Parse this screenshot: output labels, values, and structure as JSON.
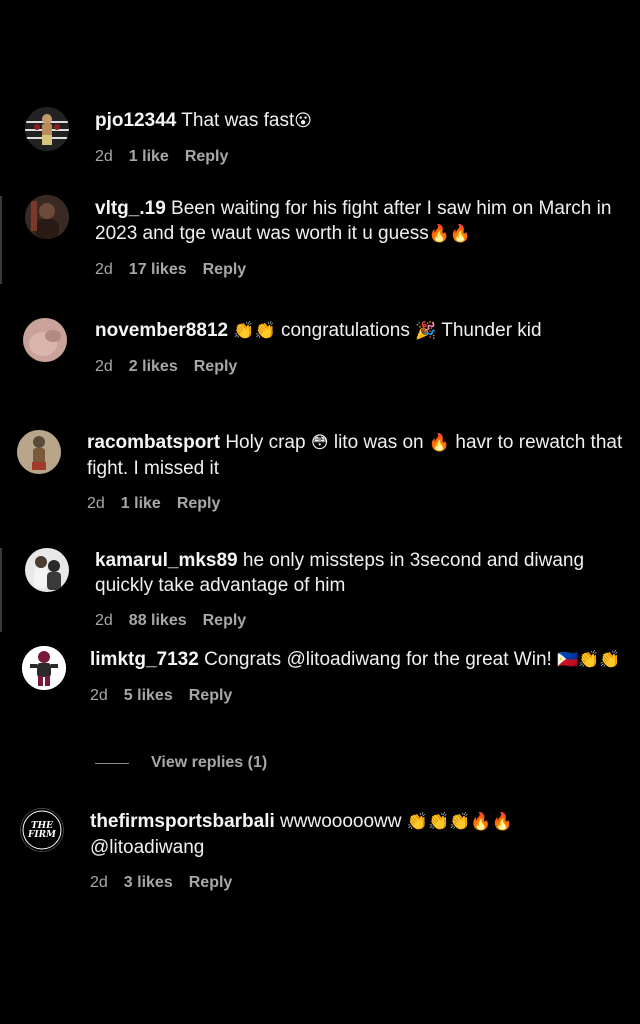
{
  "comments": [
    {
      "username": "pjo12344",
      "text": "That was fast",
      "emoji": "😮",
      "time": "2d",
      "likes": "1 like",
      "reply": "Reply"
    },
    {
      "username": "vltg_.19",
      "text": "Been waiting for his fight after I saw him on March in 2023 and tge waut was worth it u guess",
      "emoji": "🔥🔥",
      "time": "2d",
      "likes": "17 likes",
      "reply": "Reply"
    },
    {
      "username": "november8812",
      "emoji_pre": "👏👏",
      "text": "congratulations",
      "emoji_mid": "🎉",
      "text2": "Thunder kid",
      "time": "2d",
      "likes": "2 likes",
      "reply": "Reply"
    },
    {
      "username": "racombatsport",
      "text": "Holy crap",
      "emoji_a": "😳",
      "text2": "lito was on",
      "emoji_b": "🔥",
      "text3": "havr to rewatch that fight. I missed it",
      "time": "2d",
      "likes": "1 like",
      "reply": "Reply"
    },
    {
      "username": "kamarul_mks89",
      "text": "he only missteps in 3second and diwang quickly take advantage of him",
      "time": "2d",
      "likes": "88 likes",
      "reply": "Reply"
    },
    {
      "username": "limktg_7132",
      "text": "Congrats @litoadiwang for the great Win!",
      "emoji": "🇵🇭👏👏",
      "time": "2d",
      "likes": "5 likes",
      "reply": "Reply"
    },
    {
      "username": "thefirmsportsbarbali",
      "text": "wwwoooooww",
      "emoji": "👏👏👏🔥🔥",
      "text2": "@litoadiwang",
      "time": "2d",
      "likes": "3 likes",
      "reply": "Reply"
    }
  ],
  "view_replies": "View replies (1)",
  "avatars": {
    "c1": "fighter-avatar",
    "c2": "user-avatar",
    "c3": "hand-avatar",
    "c4": "fighter-avatar",
    "c5": "couple-avatar",
    "c6": "fighter-avatar",
    "c7": "the-firm-logo",
    "c7_logo_text": "THE FIRM"
  },
  "colors": {
    "background": "#000000",
    "text": "#f5f5f5",
    "meta": "#a8a8a8"
  }
}
